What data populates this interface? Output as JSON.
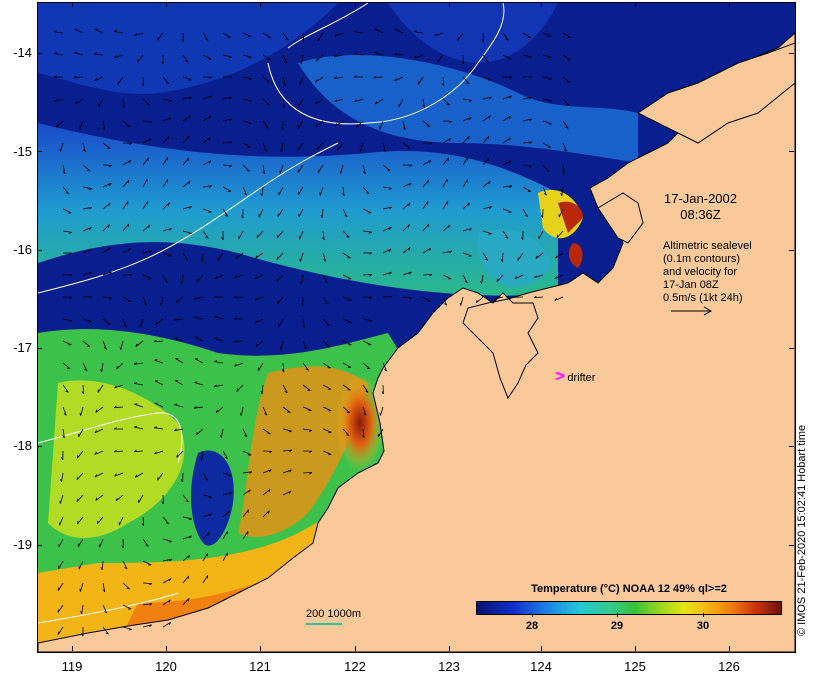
{
  "map": {
    "title": "Temperature (°C) NOAA 12 49% ql>=2",
    "latitude_labels": [
      "-14",
      "-15",
      "-16",
      "-17",
      "-18",
      "-19"
    ],
    "longitude_labels": [
      "119",
      "120",
      "121",
      "122",
      "123",
      "124",
      "125",
      "126"
    ],
    "lat_range": [
      -20.1,
      -13.6
    ],
    "lon_range": [
      118.65,
      126.7
    ],
    "date_line1": "17-Jan-2002",
    "date_line2": "08:36Z",
    "legend_lines": [
      "Altimetric sealevel",
      "(0.1m contours)",
      "and velocity for",
      "17-Jan 08Z",
      "0.5m/s (1kt 24h)"
    ],
    "drifter_symbol": ">",
    "drifter_label": "drifter",
    "colorbar_labels": [
      "28",
      "29",
      "30"
    ],
    "colorbar_range": [
      27.4,
      30.9
    ],
    "scale_label": "200  1000m",
    "credit": "© IMOS 21-Feb-2020 15:02:41 Hobart time",
    "colors": {
      "land": "#f9c99a",
      "ocean_deep": "#0a1f8f",
      "contour": "#ffffff",
      "drifter": "#ff22ff",
      "scale_line": "#30c0a0"
    }
  }
}
